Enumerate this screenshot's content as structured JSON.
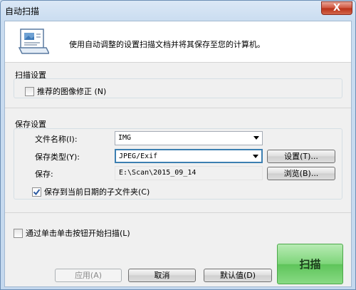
{
  "window": {
    "title": "自动扫描",
    "close_label": "X"
  },
  "header": {
    "icon": "scan-document-icon",
    "description": "使用自动调整的设置扫描文档并将其保存至您的计算机。"
  },
  "scan_settings": {
    "label": "扫描设置",
    "recommended_fix": {
      "label": "推荐的图像修正 (N)",
      "checked": false
    }
  },
  "save_settings": {
    "label": "保存设置",
    "file_name": {
      "label": "文件名称(I):",
      "value": "IMG"
    },
    "save_type": {
      "label": "保存类型(Y):",
      "value": "JPEG/Exif"
    },
    "settings_button": "设置(T)...",
    "save_to": {
      "label": "保存:",
      "value": "E:\\Scan\\2015_09_14"
    },
    "browse_button": "浏览(B)...",
    "subfolder": {
      "label": "保存到当前日期的子文件夹(C)",
      "checked": true
    }
  },
  "start_by_button": {
    "label": "通过单击单击按钮开始扫描(L)",
    "checked": false
  },
  "footer": {
    "apply": "应用(A)",
    "cancel": "取消",
    "defaults": "默认值(D)",
    "scan": "扫描"
  },
  "colors": {
    "accent": "#3c7fb1",
    "scan_button": "#7ed57a",
    "close": "#c7432a"
  }
}
